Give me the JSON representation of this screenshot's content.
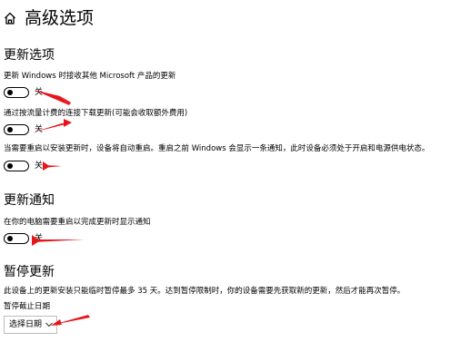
{
  "header": {
    "icon": "home-icon",
    "title": "高级选项"
  },
  "update_options": {
    "title": "更新选项",
    "settings": [
      {
        "description": "更新 Windows 时接收其他 Microsoft 产品的更新",
        "state": "关",
        "on": false
      },
      {
        "description": "通过按流量计费的连接下载更新(可能会收取额外费用)",
        "state": "关",
        "on": false
      },
      {
        "description": "当需要重启以安装更新时，设备将自动重启。重启之前 Windows 会显示一条通知，此时设备必须处于开启和电源供电状态。",
        "state": "关",
        "on": false
      }
    ]
  },
  "update_notifications": {
    "title": "更新通知",
    "setting": {
      "description": "在你的电脑需要重启以完成更新时显示通知",
      "state": "关",
      "on": false
    }
  },
  "pause_updates": {
    "title": "暂停更新",
    "description": "此设备上的更新安装只能临时暂停最多 35 天。达到暂停限制时，你的设备需要先获取新的更新，然后才能再次暂停。",
    "deadline_label": "暂停截止日期",
    "select_label": "选择日期"
  },
  "annotation_color": "#e8141c"
}
